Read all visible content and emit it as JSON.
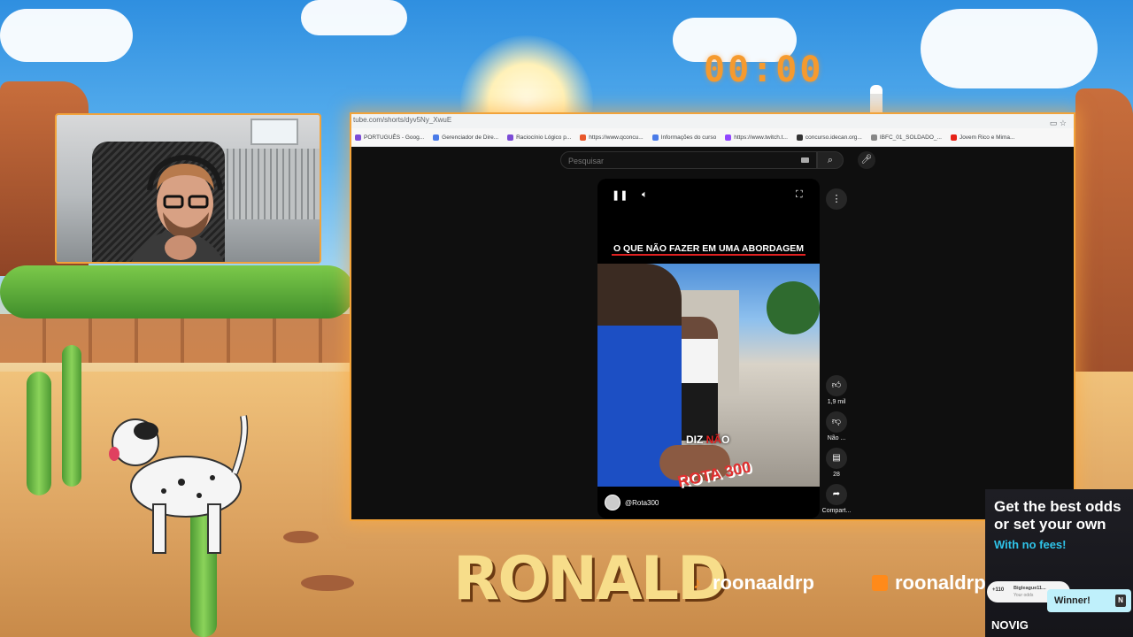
{
  "stream": {
    "timer": "00:00",
    "streamer_name": "RONALD",
    "tiktok_handle": "roonaaldrp",
    "twitch_handle": "roonaldrp"
  },
  "browser": {
    "url": "tube.com/shorts/dyv5Ny_XwuE",
    "bookmarks": [
      {
        "label": "PORTUGUÊS - Goog...",
        "color": "#7b4bd6"
      },
      {
        "label": "Gerenciador de Dire...",
        "color": "#4a7be8"
      },
      {
        "label": "Raciocínio Lógico p...",
        "color": "#7b4bd6"
      },
      {
        "label": "https://www.qconcu...",
        "color": "#e8572a"
      },
      {
        "label": "Informações do curso",
        "color": "#4a7be8"
      },
      {
        "label": "https://www.twitch.t...",
        "color": "#9146ff"
      },
      {
        "label": "concurso.idecan.org...",
        "color": "#333333"
      },
      {
        "label": "IBFC_01_SOLDADO_...",
        "color": "#888888"
      },
      {
        "label": "Jovem Rico e Mima...",
        "color": "#e62117"
      }
    ]
  },
  "youtube": {
    "search_placeholder": "Pesquisar",
    "short_headline": "O QUE NÃO FAZER EM UMA ABORDAGEM",
    "caption_before": "DIZ ",
    "caption_highlight": "NÃ",
    "caption_after": "O",
    "watermark": "ROTA 300",
    "channel": "@Rota300",
    "actions": {
      "likes": "1,9 mil",
      "dislike": "Não ...",
      "comments": "28",
      "share": "Compart..."
    }
  },
  "ad": {
    "headline": "Get the best odds or set your own",
    "subline": "With no fees!",
    "card_points": "+110",
    "card_user": "Bigleague11...",
    "card_sub": "Your odds",
    "winner": "Winner!",
    "brand": "NOVIG"
  }
}
